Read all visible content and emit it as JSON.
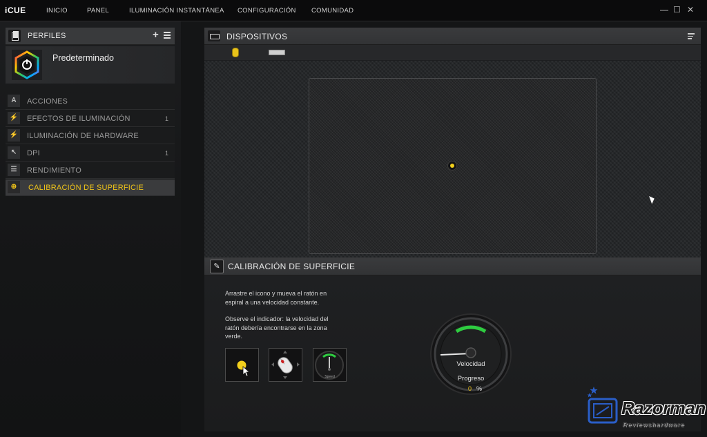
{
  "app": {
    "title": "iCUE",
    "nav": [
      "INICIO",
      "PANEL",
      "ILUMINACIÓN INSTANTÁNEA",
      "CONFIGURACIÓN",
      "COMUNIDAD"
    ],
    "window_controls": [
      "—",
      "☐",
      "✕"
    ]
  },
  "profiles": {
    "title": "PERFILES",
    "add_label": "+",
    "selected_profile": "Predeterminado"
  },
  "menu": [
    {
      "label": "ACCIONES",
      "count": "",
      "icon": "actions-icon",
      "glyph": "A"
    },
    {
      "label": "EFECTOS DE ILUMINACIÓN",
      "count": "1",
      "icon": "lightning-icon",
      "glyph": "⚡"
    },
    {
      "label": "ILUMINACIÓN DE HARDWARE",
      "count": "",
      "icon": "lightning-icon",
      "glyph": "⚡"
    },
    {
      "label": "DPI",
      "count": "1",
      "icon": "cursor-icon",
      "glyph": "↖"
    },
    {
      "label": "RENDIMIENTO",
      "count": "",
      "icon": "performance-icon",
      "glyph": "☰"
    },
    {
      "label": "CALIBRACIÓN DE SUPERFICIE",
      "count": "",
      "icon": "target-icon",
      "glyph": "⊕",
      "active": true
    }
  ],
  "devices": {
    "title": "DISPOSITIVOS"
  },
  "calibration": {
    "title": "CALIBRACIÓN DE SUPERFICIE",
    "instruction_1": [
      "Arrastre el icono y mueva el ratón en",
      "espiral a una velocidad constante."
    ],
    "instruction_2": [
      "Observe el indicador: la velocidad del",
      "ratón debería encontrarse en la zona",
      "verde."
    ],
    "speed_tile_label": "Speed",
    "gauge": {
      "speed_label": "Velocidad",
      "progress_label": "Progreso",
      "progress_value": "0",
      "progress_unit": "%"
    }
  },
  "watermark": {
    "brand": "Razorman",
    "tagline": "Reviewshardware"
  },
  "colors": {
    "accent": "#f0c419",
    "green_zone": "#2ecc40"
  }
}
